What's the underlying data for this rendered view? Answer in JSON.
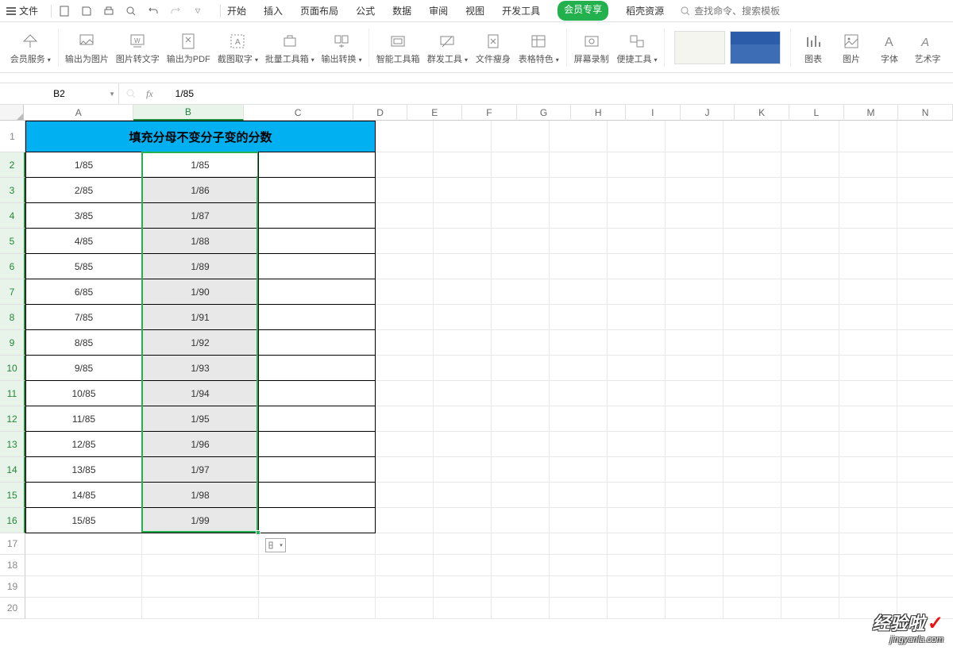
{
  "menu": {
    "file": "文件",
    "tabs": [
      "开始",
      "插入",
      "页面布局",
      "公式",
      "数据",
      "审阅",
      "视图",
      "开发工具",
      "会员专享",
      "稻壳资源"
    ],
    "vip_index": 8,
    "search_placeholder": "查找命令、搜索模板"
  },
  "ribbon": {
    "items": [
      {
        "label": "会员服务",
        "dd": true
      },
      {
        "label": "输出为图片"
      },
      {
        "label": "图片转文字"
      },
      {
        "label": "输出为PDF"
      },
      {
        "label": "截图取字",
        "dd": true
      },
      {
        "label": "批量工具箱",
        "dd": true
      },
      {
        "label": "输出转换",
        "dd": true
      },
      {
        "label": "智能工具箱"
      },
      {
        "label": "群发工具",
        "dd": true
      },
      {
        "label": "文件瘦身"
      },
      {
        "label": "表格特色",
        "dd": true
      },
      {
        "label": "屏幕录制"
      },
      {
        "label": "便捷工具",
        "dd": true
      },
      {
        "label": "图表"
      },
      {
        "label": "图片"
      },
      {
        "label": "字体"
      },
      {
        "label": "艺术字"
      }
    ],
    "sep_after": [
      0,
      6,
      10,
      12,
      12
    ]
  },
  "namebox": "B2",
  "formula": "1/85",
  "columns": [
    "A",
    "B",
    "C",
    "D",
    "E",
    "F",
    "G",
    "H",
    "I",
    "J",
    "K",
    "L",
    "M",
    "N"
  ],
  "col_widths": {
    "A": 147,
    "B": 147,
    "C": 147,
    "rest": 73
  },
  "row_heights": {
    "title": 40,
    "data": 32,
    "rest": 27
  },
  "title_text": "填充分母不变分子变的分数",
  "rows": [
    {
      "a": "1/85",
      "b": "1/85"
    },
    {
      "a": "2/85",
      "b": "1/86"
    },
    {
      "a": "3/85",
      "b": "1/87"
    },
    {
      "a": "4/85",
      "b": "1/88"
    },
    {
      "a": "5/85",
      "b": "1/89"
    },
    {
      "a": "6/85",
      "b": "1/90"
    },
    {
      "a": "7/85",
      "b": "1/91"
    },
    {
      "a": "8/85",
      "b": "1/92"
    },
    {
      "a": "9/85",
      "b": "1/93"
    },
    {
      "a": "10/85",
      "b": "1/94"
    },
    {
      "a": "11/85",
      "b": "1/95"
    },
    {
      "a": "12/85",
      "b": "1/96"
    },
    {
      "a": "13/85",
      "b": "1/97"
    },
    {
      "a": "14/85",
      "b": "1/98"
    },
    {
      "a": "15/85",
      "b": "1/99"
    }
  ],
  "visible_rows": 20,
  "autofill_label": "⬚▾",
  "watermark": {
    "line1": "经验啦",
    "line2": "jingyanla.com"
  }
}
